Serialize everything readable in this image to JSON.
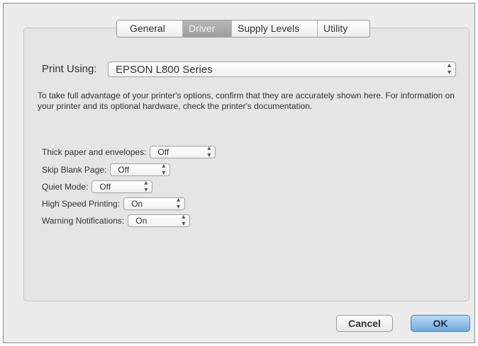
{
  "tabs": [
    {
      "label": "General",
      "selected": false
    },
    {
      "label": "Driver",
      "selected": true
    },
    {
      "label": "Supply Levels",
      "selected": false
    },
    {
      "label": "Utility",
      "selected": false
    }
  ],
  "print_using": {
    "label": "Print Using:",
    "value": "EPSON L800 Series"
  },
  "description": "To take full advantage of your printer's options, confirm that they are accurately shown here. For information on your printer and its optional hardware, check the printer's documentation.",
  "settings": [
    {
      "label": "Thick paper and envelopes:",
      "value": "Off"
    },
    {
      "label": "Skip Blank Page:",
      "value": "Off"
    },
    {
      "label": "Quiet Mode:",
      "value": "Off"
    },
    {
      "label": "High Speed Printing:",
      "value": "On"
    },
    {
      "label": "Warning Notifications:",
      "value": "On"
    }
  ],
  "buttons": {
    "cancel": "Cancel",
    "ok": "OK"
  },
  "icons": {
    "popup_arrows": "up-down-chevron-icon"
  },
  "colors": {
    "selected_tab": "#a6a6a6",
    "default_button": "#7eb5e6",
    "background": "#ececec"
  }
}
